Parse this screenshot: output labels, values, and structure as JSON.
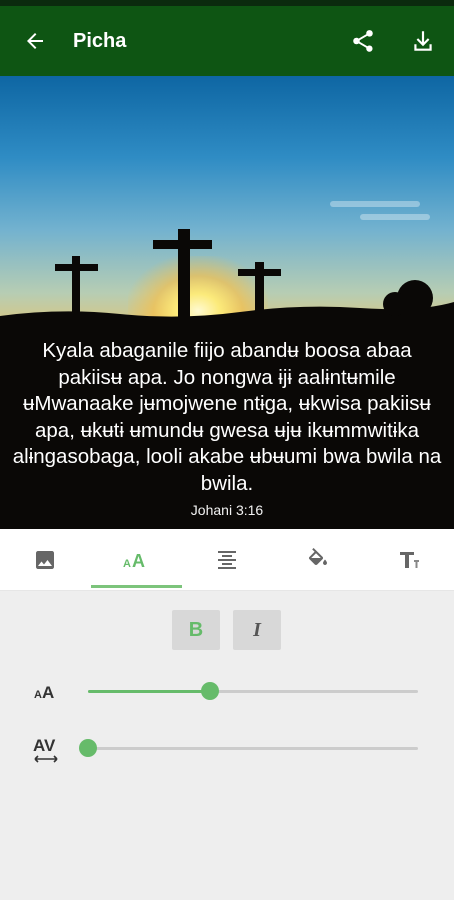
{
  "appbar": {
    "title": "Picha",
    "back_icon": "arrow-left-icon",
    "share_icon": "share-icon",
    "download_icon": "download-icon"
  },
  "image": {
    "verse_text": "Kyala abaganile fiijo abandʉ boosa abaa pakiisʉ apa. Jo nongwa ɨjɨ aalɨntʉmile ʉMwanaake jʉmojwene ntɨga, ʉkwisa pakiisʉ apa, ʉkʉtɨ ʉmundʉ gwesa ʉjʉ ikʉmmwitɨka alɨngasobaga, looli akabe ʉbʉumi bwa bwila na bwila.",
    "reference": "Johani 3:16"
  },
  "tabs": [
    {
      "name": "background-image",
      "icon": "image-icon",
      "active": false
    },
    {
      "name": "font",
      "icon": "font-size-icon",
      "active": true
    },
    {
      "name": "alignment",
      "icon": "align-center-icon",
      "active": false
    },
    {
      "name": "color",
      "icon": "paint-bucket-icon",
      "active": false
    },
    {
      "name": "text-style",
      "icon": "text-format-icon",
      "active": false
    }
  ],
  "format": {
    "bold_label": "B",
    "italic_label": "I"
  },
  "sliders": {
    "font_size_fraction": 0.37,
    "letter_spacing_fraction": 0.0
  },
  "colors": {
    "appbar": "#0e5513",
    "accent": "#66bb6a"
  }
}
